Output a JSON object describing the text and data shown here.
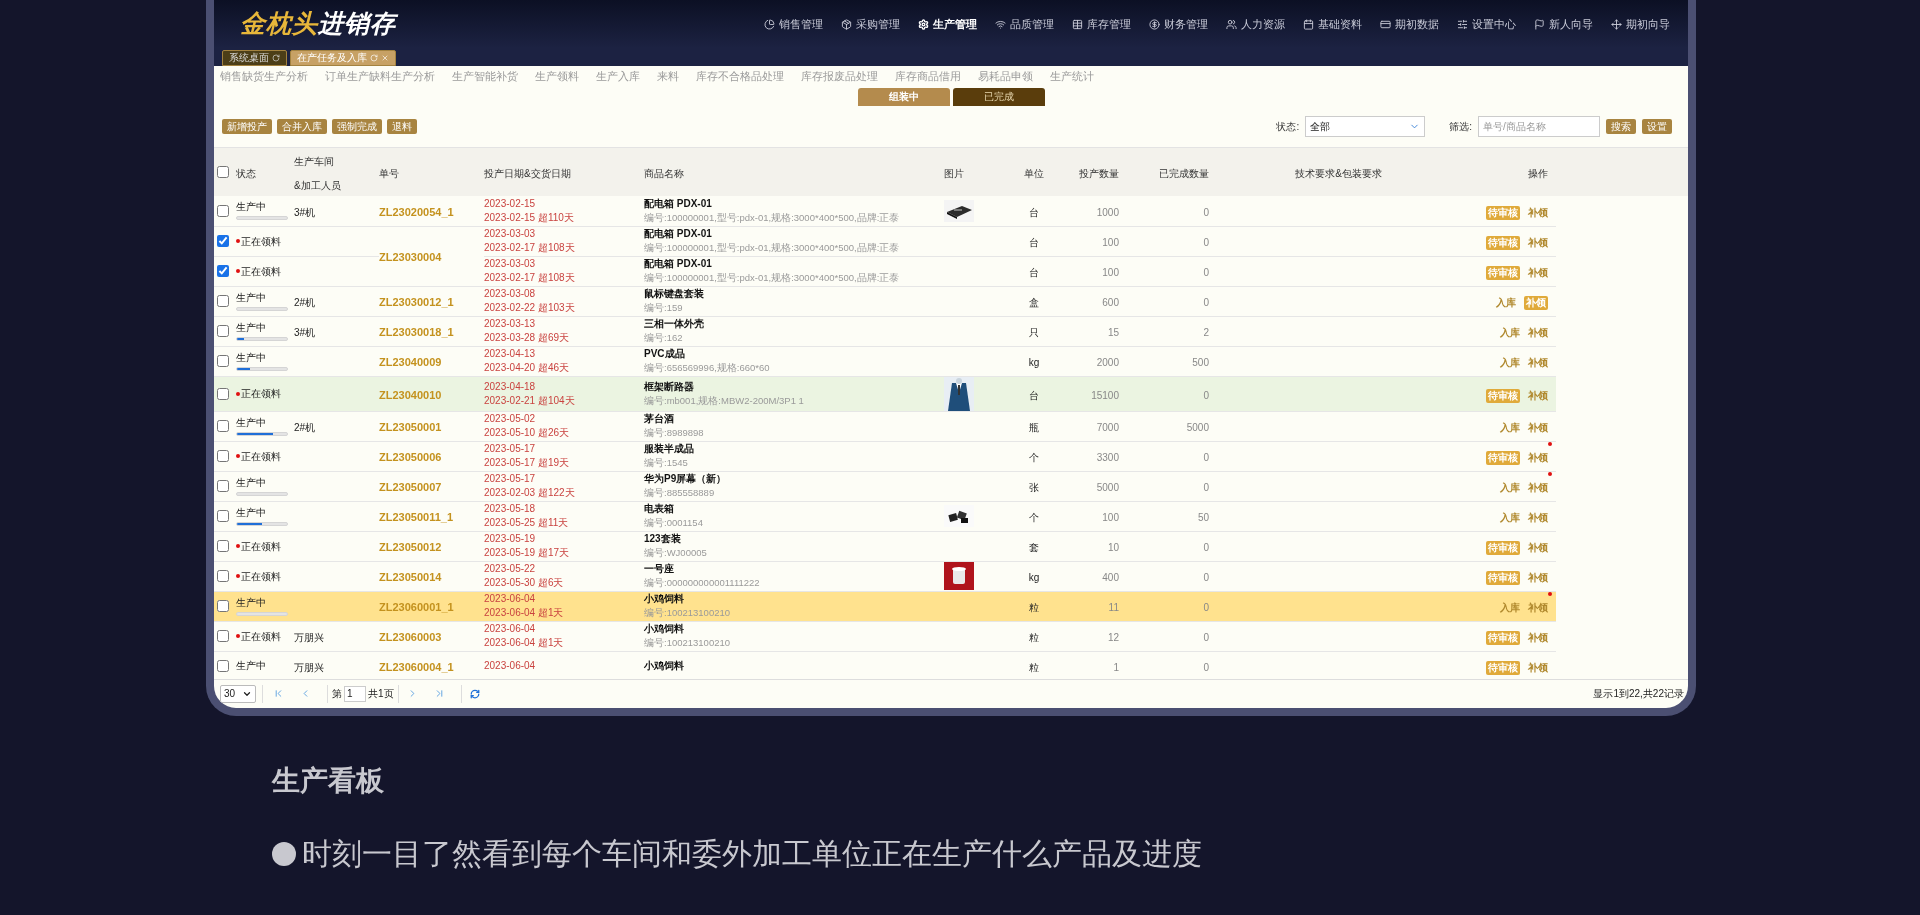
{
  "logo": {
    "brand": "金枕头",
    "product": "进销存"
  },
  "nav": [
    {
      "label": "销售管理",
      "selected": false
    },
    {
      "label": "采购管理",
      "selected": false
    },
    {
      "label": "生产管理",
      "selected": true
    },
    {
      "label": "品质管理",
      "selected": false
    },
    {
      "label": "库存管理",
      "selected": false
    },
    {
      "label": "财务管理",
      "selected": false
    },
    {
      "label": "人力资源",
      "selected": false
    },
    {
      "label": "基础资料",
      "selected": false
    },
    {
      "label": "期初数据",
      "selected": false
    },
    {
      "label": "设置中心",
      "selected": false
    },
    {
      "label": "新人向导",
      "selected": false
    },
    {
      "label": "期初向导",
      "selected": false
    }
  ],
  "tabs": [
    {
      "label": "系统桌面",
      "selected": false
    },
    {
      "label": "在产任务及入库",
      "selected": true,
      "closable": true
    }
  ],
  "subnav": [
    "销售缺货生产分析",
    "订单生产缺料生产分析",
    "生产智能补货",
    "生产领料",
    "生产入库",
    "来料",
    "库存不合格品处理",
    "库存报废品处理",
    "库存商品借用",
    "易耗品申领",
    "生产统计"
  ],
  "segments": [
    {
      "label": "组装中",
      "selected": true
    },
    {
      "label": "已完成",
      "selected": false
    }
  ],
  "toolbar": {
    "buttons": [
      "新增投产",
      "合并入库",
      "强制完成",
      "退料"
    ],
    "status_label": "状态:",
    "status_value": "全部",
    "filter_label": "筛选:",
    "filter_placeholder": "单号/商品名称",
    "search_button": "搜索",
    "settings_button": "设置"
  },
  "table": {
    "select_all": {
      "checked": false
    },
    "columns": [
      "状态",
      "生产车间\n&加工人员",
      "单号",
      "投产日期&交货日期",
      "商品名称",
      "图片",
      "单位",
      "投产数量",
      "已完成数量",
      "技术要求&包装要求",
      "操作"
    ],
    "rows": [
      {
        "checked": false,
        "status": {
          "kind": "producing",
          "label": "生产中",
          "level": 0
        },
        "workshop": "3#机",
        "order": "ZL23020054_1",
        "dates": [
          "2023-02-15",
          "2023-02-15 超110天"
        ],
        "product": "配电箱 PDX-01",
        "detail": "编号:100000001,型号:pdx-01,规格:3000*400*500,品牌:正泰",
        "picture": true,
        "unit": "台",
        "planned": "1000",
        "done": "0",
        "actions": [
          {
            "kind": "badge",
            "label": "待审核"
          },
          {
            "kind": "link",
            "label": "补领"
          }
        ]
      },
      {
        "checked": true,
        "status": {
          "kind": "picking",
          "label": "正在领料"
        },
        "order": "ZL23030004",
        "order_spans_next": true,
        "dates": [
          "2023-03-03",
          "2023-02-17 超108天"
        ],
        "product": "配电箱 PDX-01",
        "detail": "编号:100000001,型号:pdx-01,规格:3000*400*500,品牌:正泰",
        "unit": "台",
        "planned": "100",
        "done": "0",
        "actions": [
          {
            "kind": "badge",
            "label": "待审核"
          },
          {
            "kind": "link",
            "label": "补领"
          }
        ]
      },
      {
        "checked": true,
        "status": {
          "kind": "picking",
          "label": "正在领料"
        },
        "dates": [
          "2023-03-03",
          "2023-02-17 超108天"
        ],
        "product": "配电箱 PDX-01",
        "detail": "编号:100000001,型号:pdx-01,规格:3000*400*500,品牌:正泰",
        "unit": "台",
        "planned": "100",
        "done": "0",
        "actions": [
          {
            "kind": "badge",
            "label": "待审核"
          },
          {
            "kind": "link",
            "label": "补领"
          }
        ]
      },
      {
        "checked": false,
        "status": {
          "kind": "producing",
          "label": "生产中",
          "level": 0
        },
        "workshop": "2#机",
        "order": "ZL23030012_1",
        "dates": [
          "2023-03-08",
          "2023-02-22 超103天"
        ],
        "product": "鼠标键盘套装",
        "detail": "编号:159",
        "unit": "盒",
        "planned": "600",
        "done": "0",
        "actions": [
          {
            "kind": "link",
            "label": "入库"
          },
          {
            "kind": "badge",
            "label": "补领"
          }
        ]
      },
      {
        "checked": false,
        "status": {
          "kind": "producing",
          "label": "生产中",
          "level": 0.13
        },
        "workshop": "3#机",
        "order": "ZL23030018_1",
        "dates": [
          "2023-03-13",
          "2023-03-28 超69天"
        ],
        "product": "三相一体外壳",
        "detail": "编号:162",
        "unit": "只",
        "planned": "15",
        "done": "2",
        "actions": [
          {
            "kind": "link",
            "label": "入库"
          },
          {
            "kind": "link",
            "label": "补领"
          }
        ]
      },
      {
        "checked": false,
        "status": {
          "kind": "producing",
          "label": "生产中",
          "level": 0.25
        },
        "order": "ZL23040009",
        "dates": [
          "2023-04-13",
          "2023-04-20 超46天"
        ],
        "product": "PVC成品",
        "detail": "编号:656569996,规格:660*60",
        "unit": "kg",
        "planned": "2000",
        "done": "500",
        "actions": [
          {
            "kind": "link",
            "label": "入库"
          },
          {
            "kind": "link",
            "label": "补领"
          }
        ]
      },
      {
        "checked": false,
        "color": "#ebf4e1",
        "status": {
          "kind": "picking",
          "label": "正在领料"
        },
        "order": "ZL23040010",
        "dates": [
          "2023-04-18",
          "2023-02-21 超104天"
        ],
        "product": "框架断路器",
        "detail": "编号:mb001,规格:MBW2-200M/3P1 1",
        "picture": true,
        "unit": "台",
        "planned": "15100",
        "done": "0",
        "actions": [
          {
            "kind": "badge",
            "label": "待审核"
          },
          {
            "kind": "link",
            "label": "补领"
          }
        ]
      },
      {
        "checked": false,
        "status": {
          "kind": "producing",
          "label": "生产中",
          "level": 0.72
        },
        "workshop": "2#机",
        "order": "ZL23050001",
        "dates": [
          "2023-05-02",
          "2023-05-10 超26天"
        ],
        "product": "茅台酒",
        "detail": "编号:8989898",
        "unit": "瓶",
        "planned": "7000",
        "done": "5000",
        "actions": [
          {
            "kind": "link",
            "label": "入库"
          },
          {
            "kind": "link",
            "label": "补领"
          }
        ]
      },
      {
        "checked": false,
        "status": {
          "kind": "picking",
          "label": "正在领料"
        },
        "order": "ZL23050006",
        "dates": [
          "2023-05-17",
          "2023-05-17 超19天"
        ],
        "product": "服装半成品",
        "detail": "编号:1545",
        "unit": "个",
        "planned": "3300",
        "done": "0",
        "actions": [
          {
            "kind": "badge",
            "label": "待审核"
          },
          {
            "kind": "link",
            "label": "补领",
            "dot": true
          }
        ]
      },
      {
        "checked": false,
        "status": {
          "kind": "producing",
          "label": "生产中",
          "level": 0
        },
        "order": "ZL23050007",
        "dates": [
          "2023-05-17",
          "2023-02-03 超122天"
        ],
        "product": "华为P9屏幕（新）",
        "detail": "编号:885558889",
        "unit": "张",
        "planned": "5000",
        "done": "0",
        "actions": [
          {
            "kind": "link",
            "label": "入库"
          },
          {
            "kind": "link",
            "label": "补领",
            "dot": true
          }
        ]
      },
      {
        "checked": false,
        "status": {
          "kind": "producing",
          "label": "生产中",
          "level": 0.5
        },
        "order": "ZL23050011_1",
        "dates": [
          "2023-05-18",
          "2023-05-25 超11天"
        ],
        "product": "电表箱",
        "detail": "编号:0001154",
        "picture": true,
        "unit": "个",
        "planned": "100",
        "done": "50",
        "actions": [
          {
            "kind": "link",
            "label": "入库"
          },
          {
            "kind": "link",
            "label": "补领"
          }
        ]
      },
      {
        "checked": false,
        "status": {
          "kind": "picking",
          "label": "正在领料"
        },
        "order": "ZL23050012",
        "dates": [
          "2023-05-19",
          "2023-05-19 超17天"
        ],
        "product": "123套装",
        "detail": "编号:WJ00005",
        "unit": "套",
        "planned": "10",
        "done": "0",
        "actions": [
          {
            "kind": "badge",
            "label": "待审核"
          },
          {
            "kind": "link",
            "label": "补领"
          }
        ]
      },
      {
        "checked": false,
        "status": {
          "kind": "picking",
          "label": "正在领料"
        },
        "order": "ZL23050014",
        "dates": [
          "2023-05-22",
          "2023-05-30 超6天"
        ],
        "product": "一号座",
        "detail": "编号:000000000001111222",
        "picture": true,
        "unit": "kg",
        "planned": "400",
        "done": "0",
        "actions": [
          {
            "kind": "badge",
            "label": "待审核"
          },
          {
            "kind": "link",
            "label": "补领"
          }
        ]
      },
      {
        "checked": false,
        "color": "#ffe28e",
        "status": {
          "kind": "producing",
          "label": "生产中",
          "level": 0
        },
        "order": "ZL23060001_1",
        "dates": [
          "2023-06-04",
          "2023-06-04 超1天"
        ],
        "product": "小鸡饲料",
        "detail": "编号:100213100210",
        "unit": "粒",
        "planned": "11",
        "done": "0",
        "actions": [
          {
            "kind": "link",
            "label": "入库"
          },
          {
            "kind": "link",
            "label": "补领",
            "dot": true
          }
        ]
      },
      {
        "checked": false,
        "status": {
          "kind": "picking",
          "label": "正在领料"
        },
        "workshop": "万朋兴",
        "order": "ZL23060003",
        "dates": [
          "2023-06-04",
          "2023-06-04 超1天"
        ],
        "product": "小鸡饲料",
        "detail": "编号:100213100210",
        "unit": "粒",
        "planned": "12",
        "done": "0",
        "actions": [
          {
            "kind": "badge",
            "label": "待审核"
          },
          {
            "kind": "link",
            "label": "补领"
          }
        ]
      },
      {
        "checked": false,
        "status": {
          "kind": "producing",
          "label": "生产中"
        },
        "workshop": "万朋兴",
        "order": "ZL23060004_1",
        "dates": [
          "2023-06-04"
        ],
        "product": "小鸡饲料",
        "unit": "粒",
        "planned": "1",
        "done": "0",
        "actions": [
          {
            "kind": "badge",
            "label": "待审核"
          },
          {
            "kind": "link",
            "label": "补领"
          }
        ]
      }
    ]
  },
  "pagination": {
    "page_size": "30",
    "page_prefix": "第",
    "page": "1",
    "page_total": "共1页",
    "summary": "显示1到22,共22记录"
  },
  "section": {
    "title": "生产看板",
    "bullet": "时刻一目了然看到每个车间和委外加工单位正在生产什么产品及进度"
  }
}
